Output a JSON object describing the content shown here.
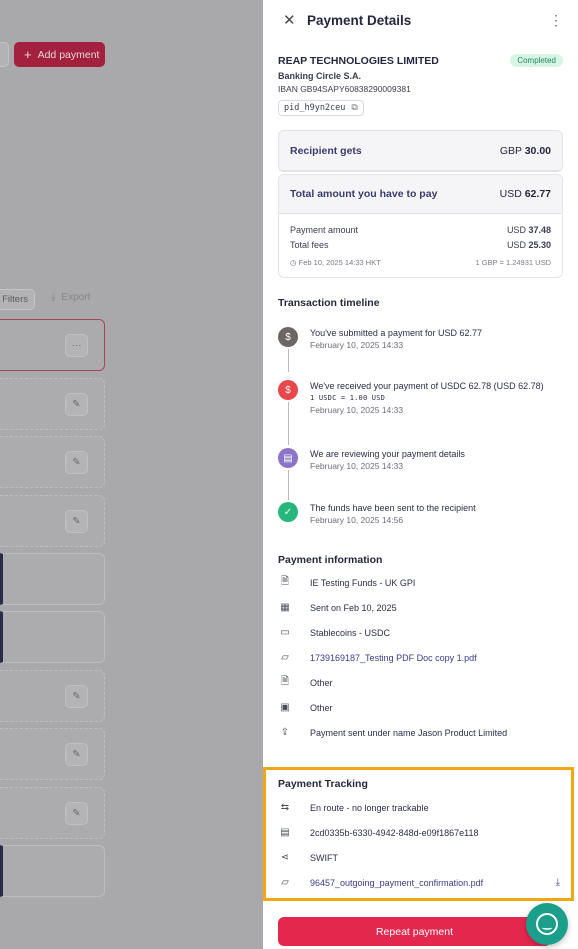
{
  "background": {
    "add_payment_label": "Add payment",
    "filters_label": "Filters",
    "export_label": "Export"
  },
  "drawer": {
    "title": "Payment Details",
    "company": "REAP TECHNOLOGIES LIMITED",
    "status": "Completed",
    "bank": "Banking Circle S.A.",
    "iban": "IBAN GB94SAPY60838290009381",
    "payment_id": "pid_h9yn2ceu",
    "recipient_gets_label": "Recipient gets",
    "recipient_gets_currency": "GBP",
    "recipient_gets_amount": "30.00",
    "total_label": "Total amount you have to pay",
    "total_currency": "USD",
    "total_amount": "62.77",
    "payment_amount_label": "Payment amount",
    "payment_amount_currency": "USD",
    "payment_amount_value": "37.48",
    "total_fees_label": "Total fees",
    "total_fees_currency": "USD",
    "total_fees_value": "25.30",
    "quote_time": "Feb 10, 2025 14:33 HKT",
    "fx_rate": "1 GBP = 1.24931 USD"
  },
  "timeline": {
    "heading": "Transaction timeline",
    "items": [
      {
        "text": "You've submitted a payment for USD 62.77",
        "date": "February 10, 2025 14:33",
        "color": "#6e6566"
      },
      {
        "text": "We've received your payment of USDC 62.78 (USD 62.78)",
        "rate": "1 USDC = 1.00 USD",
        "date": "February 10, 2025 14:33",
        "color": "#e8474c"
      },
      {
        "text": "We are reviewing your payment details",
        "date": "February 10, 2025 14:33",
        "color": "#8c75c9"
      },
      {
        "text": "The funds have been sent to the recipient",
        "date": "February 10, 2025 14:56",
        "color": "#27b77a"
      }
    ]
  },
  "payment_info": {
    "heading": "Payment information",
    "rows": [
      {
        "icon": "document-icon",
        "text": "IE Testing Funds - UK GPI"
      },
      {
        "icon": "calendar-icon",
        "text": "Sent on Feb 10, 2025"
      },
      {
        "icon": "wallet-icon",
        "text": "Stablecoins - USDC"
      },
      {
        "icon": "folder-icon",
        "text": "1739169187_Testing PDF Doc copy 1.pdf"
      },
      {
        "icon": "document-icon",
        "text": "Other"
      },
      {
        "icon": "banknote-icon",
        "text": "Other"
      },
      {
        "icon": "file-upload-icon",
        "text": "Payment sent under name Jason Product Limited"
      }
    ]
  },
  "tracking": {
    "heading": "Payment Tracking",
    "status": "En route - no longer trackable",
    "reference": "2cd0335b-6330-4942-848d-e09f1867e118",
    "network": "SWIFT",
    "confirmation_file": "96457_outgoing_payment_confirmation.pdf"
  },
  "actions": {
    "repeat_label": "Repeat payment"
  },
  "colors": {
    "brand": "#e4284d",
    "highlight": "#f0a712",
    "chat": "#1b9f8a"
  }
}
